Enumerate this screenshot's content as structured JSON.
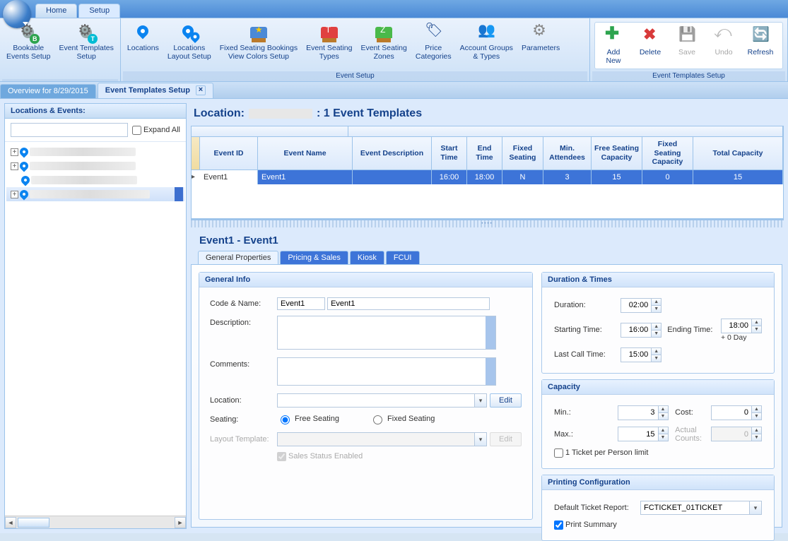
{
  "top_tabs": {
    "home": "Home",
    "setup": "Setup"
  },
  "ribbon": {
    "group1_label": "",
    "group2_label": "Event Setup",
    "group3_label": "Event Templates Setup",
    "bookable": "Bookable\nEvents Setup",
    "templates": "Event Templates\nSetup",
    "locations": "Locations",
    "layout": "Locations\nLayout Setup",
    "fixedbook": "Fixed Seating Bookings\nView Colors Setup",
    "seattypes": "Event Seating\nTypes",
    "seatzones": "Event Seating\nZones",
    "pricecat": "Price\nCategories",
    "acctgroups": "Account Groups\n& Types",
    "params": "Parameters",
    "addnew": "Add New",
    "delete": "Delete",
    "save": "Save",
    "undo": "Undo",
    "refresh": "Refresh",
    "close": "Close"
  },
  "worksheet": {
    "overview": "Overview for 8/29/2015",
    "templates": "Event Templates Setup"
  },
  "left": {
    "header": "Locations & Events:",
    "expand_all": "Expand All"
  },
  "loc_header": {
    "prefix": "Location:",
    "suffix": ":  1 Event Templates"
  },
  "grid": {
    "headers": {
      "eventid": "Event ID",
      "eventname": "Event Name",
      "desc": "Event Description",
      "stime": "Start Time",
      "etime": "End Time",
      "fseat": "Fixed Seating",
      "minat": "Min. Attendees",
      "fscap": "Free Seating Capacity",
      "fxcap": "Fixed Seating Capacity",
      "tcap": "Total Capacity"
    },
    "row": {
      "eventid": "Event1",
      "eventname": "Event1",
      "desc": "",
      "stime": "16:00",
      "etime": "18:00",
      "fseat": "N",
      "minat": "3",
      "fscap": "15",
      "fxcap": "0",
      "tcap": "15"
    }
  },
  "detail": {
    "title": "Event1   -   Event1",
    "tabs": {
      "gp": "General Properties",
      "ps": "Pricing & Sales",
      "kiosk": "Kiosk",
      "fcui": "FCUI"
    },
    "general_info": {
      "title": "General Info",
      "code_name_lbl": "Code & Name:",
      "code": "Event1",
      "name": "Event1",
      "desc_lbl": "Description:",
      "desc": "",
      "comments_lbl": "Comments:",
      "comments": "",
      "location_lbl": "Location:",
      "location": "",
      "edit_btn": "Edit",
      "seating_lbl": "Seating:",
      "free_seating": "Free Seating",
      "fixed_seating": "Fixed Seating",
      "layout_lbl": "Layout Template:",
      "layout": "",
      "sales_status": "Sales Status Enabled"
    },
    "duration": {
      "title": "Duration & Times",
      "duration_lbl": "Duration:",
      "duration": "02:00",
      "start_lbl": "Starting Time:",
      "start": "16:00",
      "end_lbl": "Ending Time:",
      "end": "18:00",
      "day_suffix": "+ 0 Day",
      "lastcall_lbl": "Last Call Time:",
      "lastcall": "15:00"
    },
    "capacity": {
      "title": "Capacity",
      "min_lbl": "Min.:",
      "min": "3",
      "max_lbl": "Max.:",
      "max": "15",
      "cost_lbl": "Cost:",
      "cost": "0",
      "actual_lbl": "Actual Counts:",
      "actual": "0",
      "ticket_limit": "1 Ticket per Person limit"
    },
    "printing": {
      "title": "Printing Configuration",
      "default_lbl": "Default Ticket Report:",
      "default": "FCTICKET_01TICKET",
      "print_summary": "Print Summary"
    }
  }
}
